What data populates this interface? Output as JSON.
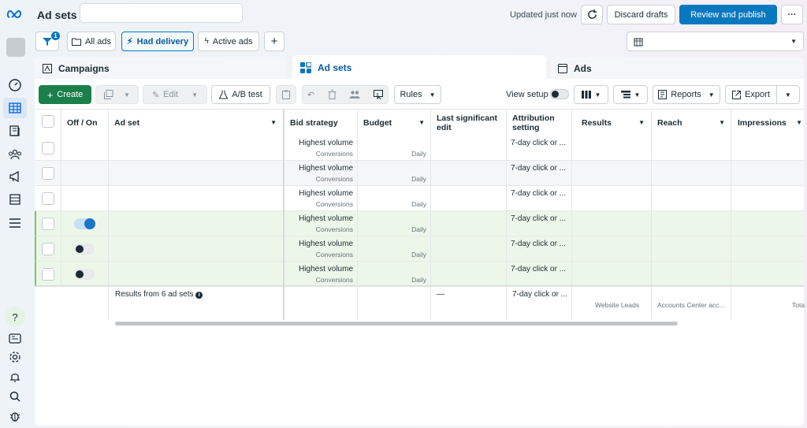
{
  "header": {
    "title": "Ad sets",
    "updated": "Updated just now",
    "discard": "Discard drafts",
    "review": "Review and publish",
    "more": "···"
  },
  "filters": {
    "badge": "1",
    "all_ads": "All ads",
    "had_delivery": "Had delivery",
    "active_ads": "Active ads",
    "add": "+"
  },
  "tabs": {
    "campaigns": "Campaigns",
    "ad_sets": "Ad sets",
    "ads": "Ads"
  },
  "toolbar": {
    "create": "Create",
    "edit": "Edit",
    "ab_test": "A/B test",
    "rules": "Rules",
    "view_setup": "View setup",
    "reports": "Reports",
    "export": "Export"
  },
  "columns": {
    "off_on": "Off / On",
    "ad_set": "Ad set",
    "bid_strategy": "Bid strategy",
    "budget": "Budget",
    "last_edit": "Last significant edit",
    "attribution": "Attribution setting",
    "results": "Results",
    "reach": "Reach",
    "impressions": "Impressions"
  },
  "rows": [
    {
      "bid": "Highest volume",
      "bid_sub": "Conversions",
      "budget_sub": "Daily",
      "attr": "7-day click or ...",
      "toggle": "none"
    },
    {
      "bid": "Highest volume",
      "bid_sub": "Conversions",
      "budget_sub": "Daily",
      "attr": "7-day click or ...",
      "toggle": "none"
    },
    {
      "bid": "Highest volume",
      "bid_sub": "Conversions",
      "budget_sub": "Daily",
      "attr": "7-day click or ...",
      "toggle": "none"
    },
    {
      "bid": "Highest volume",
      "bid_sub": "Conversions",
      "budget_sub": "Daily",
      "attr": "7-day click or ...",
      "toggle": "on"
    },
    {
      "bid": "Highest volume",
      "bid_sub": "Conversions",
      "budget_sub": "Daily",
      "attr": "7-day click or ...",
      "toggle": "off"
    },
    {
      "bid": "Highest volume",
      "bid_sub": "Conversions",
      "budget_sub": "Daily",
      "attr": "7-day click or ...",
      "toggle": "off"
    }
  ],
  "summary": {
    "label": "Results from 6 ad sets",
    "last_edit": "—",
    "attr": "7-day click or ...",
    "results_sub": "Website Leads",
    "reach_sub": "Accounts Center acc...",
    "impressions_sub": "Tota"
  },
  "colors": {
    "primary": "#0a78be",
    "create": "#1b7f4b",
    "highlight_row": "#edf7e9"
  }
}
